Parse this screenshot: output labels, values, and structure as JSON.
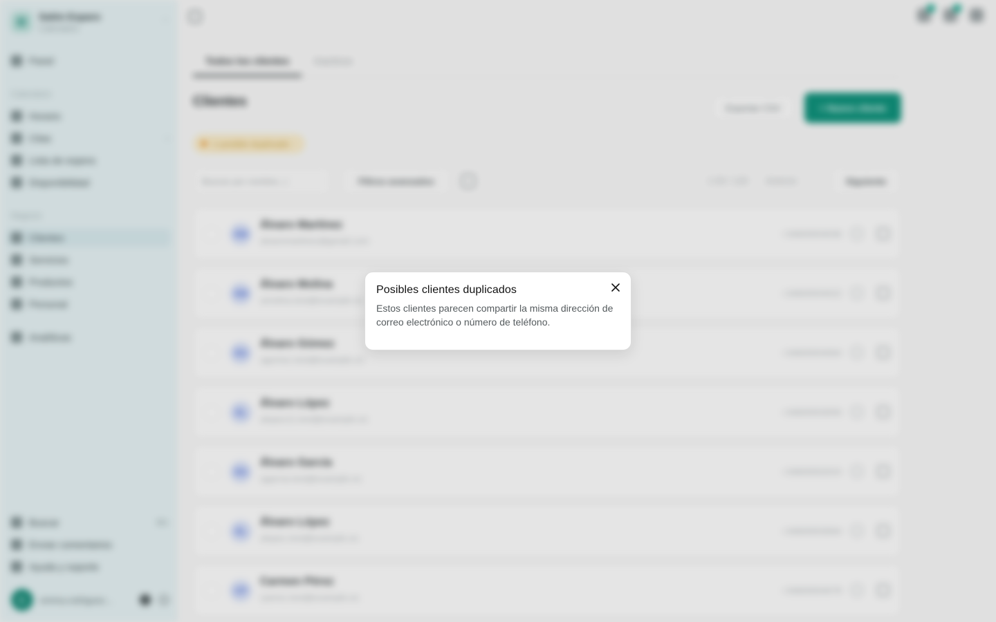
{
  "sidebar": {
    "business_name": "Salón Esparo",
    "business_sub": "Calendario",
    "panel": "Panel",
    "section_calendar": "Calendario",
    "calendar_items": [
      "Horario",
      "Citas",
      "Lista de espera",
      "Disponibilidad"
    ],
    "section_business": "Negocio",
    "business_items": [
      "Clientes",
      "Servicios",
      "Productos",
      "Personal"
    ],
    "analytics": "Analíticas",
    "search": "Buscar",
    "search_kbd": "⌘K",
    "feedback": "Enviar comentarios",
    "help": "Ayuda y soporte",
    "user_initial": "E",
    "user_email": "emma.rodriguez..."
  },
  "main": {
    "tabs": [
      "Todos los clientes",
      "Inactivos"
    ],
    "page_title": "Clientes",
    "export_label": "Exportar CSV",
    "new_client_label": "+ Nuevo cliente",
    "duplicate_badge": "1 posible duplicado",
    "search_placeholder": "Buscar por nombre, c",
    "filters_label": "Filtros avanzados",
    "pager_range": "1-50 / 120",
    "pager_prev": "Anterior",
    "pager_next": "Siguiente",
    "clients": [
      {
        "initials": "ÁM",
        "name": "Álvaro Martínez",
        "email": "alvaromartinez@gmail.com",
        "phone": "+34600004036"
      },
      {
        "initials": "ÁM",
        "name": "Álvaro Molina",
        "email": "amolina.test@example.es",
        "phone": "+34600004022"
      },
      {
        "initials": "ÁG",
        "name": "Álvaro Gómez",
        "email": "agomez.test@example.es",
        "phone": "+34600004064"
      },
      {
        "initials": "ÁL",
        "name": "Álvaro López",
        "email": "alopez11.test@example.es",
        "phone": "+34600003056"
      },
      {
        "initials": "ÁG",
        "name": "Álvaro García",
        "email": "agarcia.test@example.es",
        "phone": "+34600002024"
      },
      {
        "initials": "ÁL",
        "name": "Álvaro López",
        "email": "alopez.test@example.es",
        "phone": "+34600003064"
      },
      {
        "initials": "CP",
        "name": "Carmen Pérez",
        "email": "cperez.test@example.es",
        "phone": "+34600004078"
      }
    ]
  },
  "popover": {
    "title": "Posibles clientes duplicados",
    "body": "Estos clientes parecen compartir la misma dirección de correo electrónico o número de teléfono."
  },
  "colors": {
    "accent": "#10907a",
    "sidebar_bg": "#e2eef0",
    "warning": "#e08a1e"
  }
}
